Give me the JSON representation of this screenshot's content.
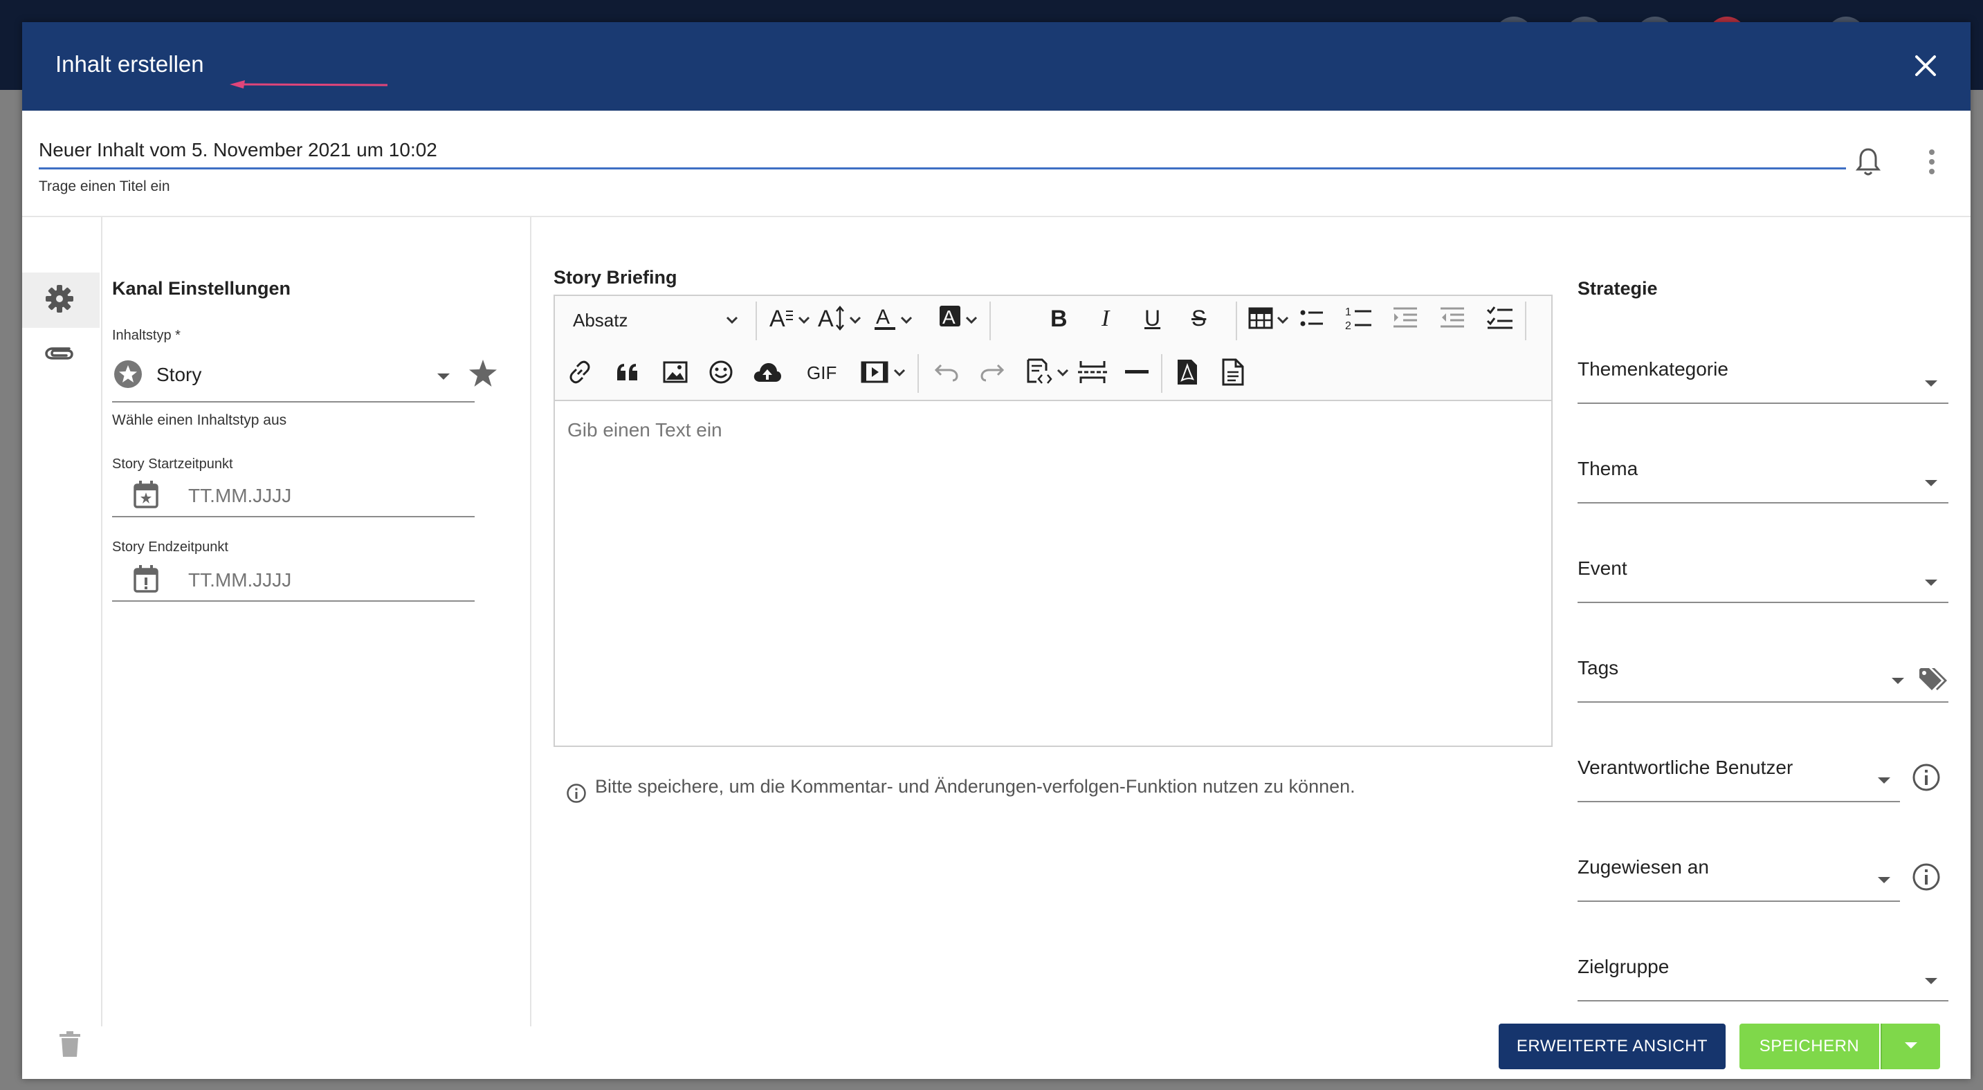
{
  "modal": {
    "title": "Inhalt erstellen",
    "content_title_value": "Neuer Inhalt vom 5. November 2021 um 10:02",
    "content_title_hint": "Trage einen Titel ein"
  },
  "left_panel": {
    "heading": "Kanal Einstellungen",
    "content_type_label": "Inhaltstyp *",
    "content_type_value": "Story",
    "content_type_helper": "Wähle einen Inhaltstyp aus",
    "start_label": "Story Startzeitpunkt",
    "start_placeholder": "TT.MM.JJJJ",
    "end_label": "Story Endzeitpunkt",
    "end_placeholder": "TT.MM.JJJJ"
  },
  "editor": {
    "heading": "Story Briefing",
    "paragraph_style": "Absatz",
    "gif_label": "GIF",
    "placeholder": "Gib einen Text ein",
    "info_note": "Bitte speichere, um die Kommentar- und Änderungen-verfolgen-Funktion nutzen zu können."
  },
  "strategy": {
    "heading": "Strategie",
    "fields": [
      "Themenkategorie",
      "Thema",
      "Event",
      "Tags",
      "Verantwortliche Benutzer",
      "Zugewiesen an",
      "Zielgruppe"
    ]
  },
  "footer": {
    "advanced_label": "ERWEITERTE ANSICHT",
    "save_label": "SPEICHERN"
  },
  "colors": {
    "header_bg": "#1a3a72",
    "primary_button": "#16356d",
    "save_button": "#7fd84a",
    "input_underline": "#3e6fc4"
  }
}
